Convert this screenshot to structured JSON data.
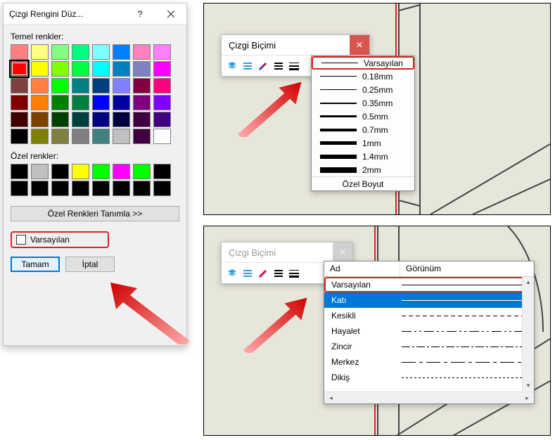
{
  "color_dialog": {
    "title": "Çizgi Rengini Düz...",
    "help": "?",
    "basic_label": "Temel renkler:",
    "basic_colors": [
      "#ff8080",
      "#ffff80",
      "#80ff80",
      "#00ff80",
      "#80ffff",
      "#0080ff",
      "#ff80c0",
      "#ff80ff",
      "#ff0000",
      "#ffff00",
      "#80ff00",
      "#00ff40",
      "#00ffff",
      "#0080c0",
      "#8080c0",
      "#ff00ff",
      "#804040",
      "#ff8040",
      "#00ff00",
      "#008080",
      "#004080",
      "#8080ff",
      "#800040",
      "#ff0080",
      "#800000",
      "#ff8000",
      "#008000",
      "#008040",
      "#0000ff",
      "#0000a0",
      "#800080",
      "#8000ff",
      "#400000",
      "#804000",
      "#004000",
      "#004040",
      "#000080",
      "#000040",
      "#400040",
      "#400080",
      "#000000",
      "#808000",
      "#808040",
      "#808080",
      "#408080",
      "#c0c0c0",
      "#400040",
      "#ffffff"
    ],
    "selected_basic_index": 8,
    "custom_label": "Özel renkler:",
    "custom_colors": [
      "#000000",
      "#c0c0c0",
      "#000000",
      "#ffff00",
      "#00ff00",
      "#ff00ff",
      "#00ff00",
      "#000000",
      "#000000",
      "#000000",
      "#000000",
      "#000000",
      "#000000",
      "#000000",
      "#000000",
      "#000000"
    ],
    "define_label": "Özel Renkleri Tanımla >>",
    "default_checkbox_label": "Varsayılan",
    "ok": "Tamam",
    "cancel": "İptal"
  },
  "style_panel_top": {
    "title": "Çizgi Biçimi",
    "width_options": [
      {
        "label": "Varsayılan",
        "px": 1,
        "highlight": true
      },
      {
        "label": "0.18mm",
        "px": 1
      },
      {
        "label": "0.25mm",
        "px": 1.5
      },
      {
        "label": "0.35mm",
        "px": 2
      },
      {
        "label": "0.5mm",
        "px": 3
      },
      {
        "label": "0.7mm",
        "px": 4
      },
      {
        "label": "1mm",
        "px": 5
      },
      {
        "label": "1.4mm",
        "px": 6
      },
      {
        "label": "2mm",
        "px": 8
      }
    ],
    "footer": "Özel Boyut"
  },
  "style_panel_bottom": {
    "title": "Çizgi Biçimi",
    "col_name": "Ad",
    "col_view": "Görünüm",
    "rows": [
      {
        "name": "Varsayılan",
        "dash": "solid",
        "highlight": true
      },
      {
        "name": "Katı",
        "dash": "solid",
        "selected": true
      },
      {
        "name": "Kesikli",
        "dash": "6 4"
      },
      {
        "name": "Hayalet",
        "dash": "14 4 3 4 3 4"
      },
      {
        "name": "Zincir",
        "dash": "12 3 3 3"
      },
      {
        "name": "Merkez",
        "dash": "20 5 5 5"
      },
      {
        "name": "Dikiş",
        "dash": "3 3"
      }
    ]
  },
  "icons": {
    "stack": "stack-icon",
    "lines": "lines-icon",
    "palette": "palette-icon",
    "menu": "menu-icon",
    "width": "width-icon"
  }
}
